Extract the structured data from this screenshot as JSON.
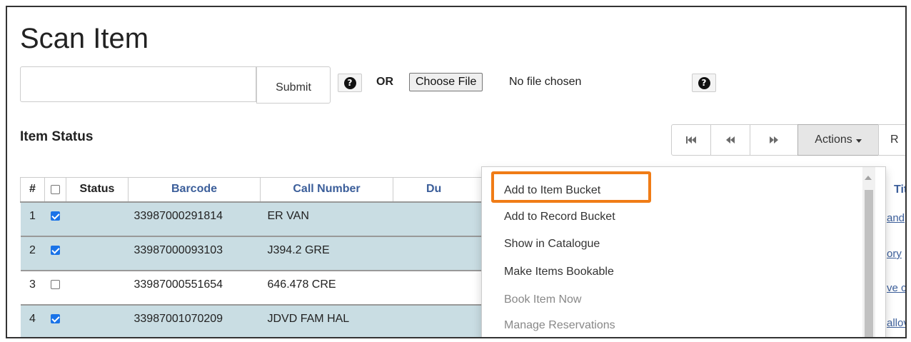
{
  "page": {
    "title": "Scan Item"
  },
  "scan": {
    "input_value": "",
    "submit_label": "Submit",
    "or_label": "OR",
    "choose_file_label": "Choose File",
    "file_status": "No file chosen"
  },
  "section": {
    "title": "Item Status"
  },
  "toolbar": {
    "first_icon": "skip-to-start-icon",
    "prev_icon": "rewind-icon",
    "next_icon": "fast-forward-icon",
    "actions_label": "Actions",
    "next_partial_label": "R"
  },
  "table": {
    "headers": {
      "num": "#",
      "status": "Status",
      "barcode": "Barcode",
      "call_number": "Call Number",
      "due": "Du",
      "title": "Titl"
    },
    "rows": [
      {
        "num": "1",
        "checked": true,
        "status": "",
        "barcode": "33987000291814",
        "call_number": "ER VAN",
        "title": "and"
      },
      {
        "num": "2",
        "checked": true,
        "status": "",
        "barcode": "33987000093103",
        "call_number": "J394.2 GRE",
        "title": "ory"
      },
      {
        "num": "3",
        "checked": false,
        "status": "",
        "barcode": "33987000551654",
        "call_number": "646.478 CRE",
        "title": "ve c"
      },
      {
        "num": "4",
        "checked": true,
        "status": "",
        "barcode": "33987001070209",
        "call_number": "JDVD FAM HAL",
        "title": "allov"
      }
    ]
  },
  "actions_menu": {
    "items": [
      {
        "label": "Add to Item Bucket",
        "disabled": false,
        "highlighted": true
      },
      {
        "label": "Add to Record Bucket",
        "disabled": false
      },
      {
        "label": "Show in Catalogue",
        "disabled": false
      },
      {
        "label": "Make Items Bookable",
        "disabled": false
      },
      {
        "label": "Book Item Now",
        "disabled": true
      },
      {
        "label": "Manage Reservations",
        "disabled": true
      }
    ]
  },
  "colors": {
    "highlight": "#f07c16",
    "selected_row": "#c9dde3",
    "link": "#3b5e9a",
    "checkbox": "#1a73e8"
  }
}
